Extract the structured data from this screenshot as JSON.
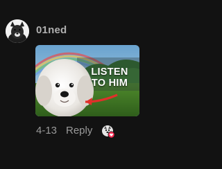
{
  "comment": {
    "username": "01ned",
    "date": "4-13",
    "reply_label": "Reply",
    "media": {
      "overlay_line1": "LISTEN",
      "overlay_line2": "TO HIM"
    },
    "liked_by_creator_icon": "heart-badge-icon"
  },
  "colors": {
    "background": "#121212",
    "username": "#b0b0b0",
    "meta_text": "#9a9a9a",
    "heart": "#fe2c55"
  }
}
